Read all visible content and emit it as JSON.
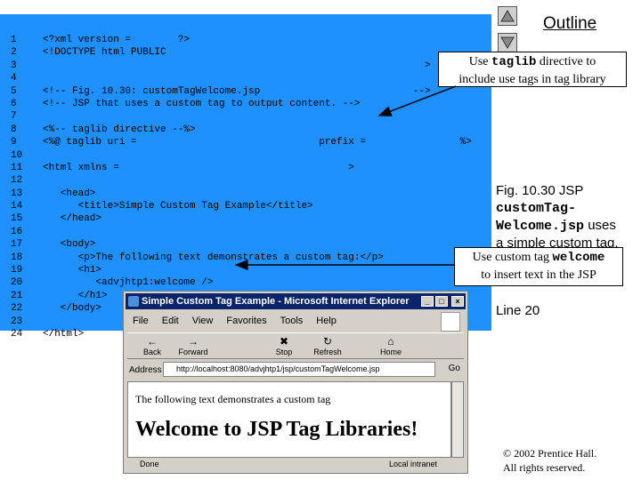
{
  "code": {
    "line_numbers": [
      "1",
      "2",
      "3",
      "4",
      "5",
      "6",
      "7",
      "8",
      "9",
      "10",
      "11",
      "12",
      "13",
      "14",
      "15",
      "16",
      "17",
      "18",
      "19",
      "20",
      "21",
      "22",
      "23",
      "24"
    ],
    "lines": [
      [
        {
          "t": "<?xml version = ",
          "c": 0
        },
        {
          "t": "?>",
          "c": 23
        }
      ],
      [
        {
          "t": "<!DOCTYPE html PUBLIC",
          "c": 0
        }
      ],
      [
        {
          "t": ">",
          "c": 65
        }
      ],
      [],
      [
        {
          "t": "<!-- Fig. 10.30: customTagWelcome.jsp",
          "c": 0
        },
        {
          "t": "-->",
          "c": 63
        }
      ],
      [
        {
          "t": "<!-- JSP that uses a custom tag to output content. -->",
          "c": 0
        }
      ],
      [],
      [
        {
          "t": "<%-- taglib directive --%>",
          "c": 0
        }
      ],
      [
        {
          "t": "<%@ taglib uri =",
          "c": 0
        },
        {
          "t": "prefix =",
          "c": 47
        },
        {
          "t": "%>",
          "c": 71
        }
      ],
      [],
      [
        {
          "t": "<html xmlns =",
          "c": 0
        },
        {
          "t": ">",
          "c": 52
        }
      ],
      [],
      [
        {
          "t": "   <head>",
          "c": 0
        }
      ],
      [
        {
          "t": "      <title>Simple Custom Tag Example</title>",
          "c": 0
        }
      ],
      [
        {
          "t": "   </head>",
          "c": 0
        }
      ],
      [],
      [
        {
          "t": "   <body>",
          "c": 0
        }
      ],
      [
        {
          "t": "      <p>The following text demonstrates a custom tag:</p>",
          "c": 0
        }
      ],
      [
        {
          "t": "      <h1>",
          "c": 0
        }
      ],
      [
        {
          "t": "         <advjhtp1:welcome />",
          "c": 0
        }
      ],
      [
        {
          "t": "      </h1>",
          "c": 0
        }
      ],
      [
        {
          "t": "   </body>",
          "c": 0
        }
      ],
      [],
      [
        {
          "t": "</html>",
          "c": 0
        }
      ]
    ]
  },
  "nav": {
    "outline": "Outline"
  },
  "callout1": {
    "pre": "Use ",
    "code": "taglib",
    "post": " directive to",
    "line2": "include use tags in tag library"
  },
  "callout2": {
    "pre": "Use custom tag ",
    "code": "welcome",
    "line2": "to insert text in the JSP"
  },
  "caption": {
    "fig": "Fig. 10.30",
    "rest": "  JSP",
    "mono1": "customTag-",
    "mono2": "Welcome.jsp",
    "tail": " uses",
    "line4": "a simple custom tag."
  },
  "line_ref": "Line 20",
  "copyright": {
    "line1": "© 2002 Prentice Hall.",
    "line2": "All rights reserved."
  },
  "ie": {
    "title": "Simple Custom Tag Example - Microsoft Internet Explorer",
    "menu": [
      "File",
      "Edit",
      "View",
      "Favorites",
      "Tools",
      "Help"
    ],
    "toolbar": [
      {
        "label": "Back",
        "glyph": "←"
      },
      {
        "label": "Forward",
        "glyph": "→"
      },
      {
        "label": "Stop",
        "glyph": "✖"
      },
      {
        "label": "Refresh",
        "glyph": "↻"
      },
      {
        "label": "Home",
        "glyph": "⌂"
      }
    ],
    "address_label": "Address",
    "address": "http://localhost:8080/advjhtp1/jsp/customTagWelcome.jsp",
    "go": "Go",
    "content_text": "The following text demonstrates a custom tag",
    "content_h1": "Welcome to JSP Tag Libraries!",
    "status_left": "Done",
    "status_right": "Local intranet"
  }
}
